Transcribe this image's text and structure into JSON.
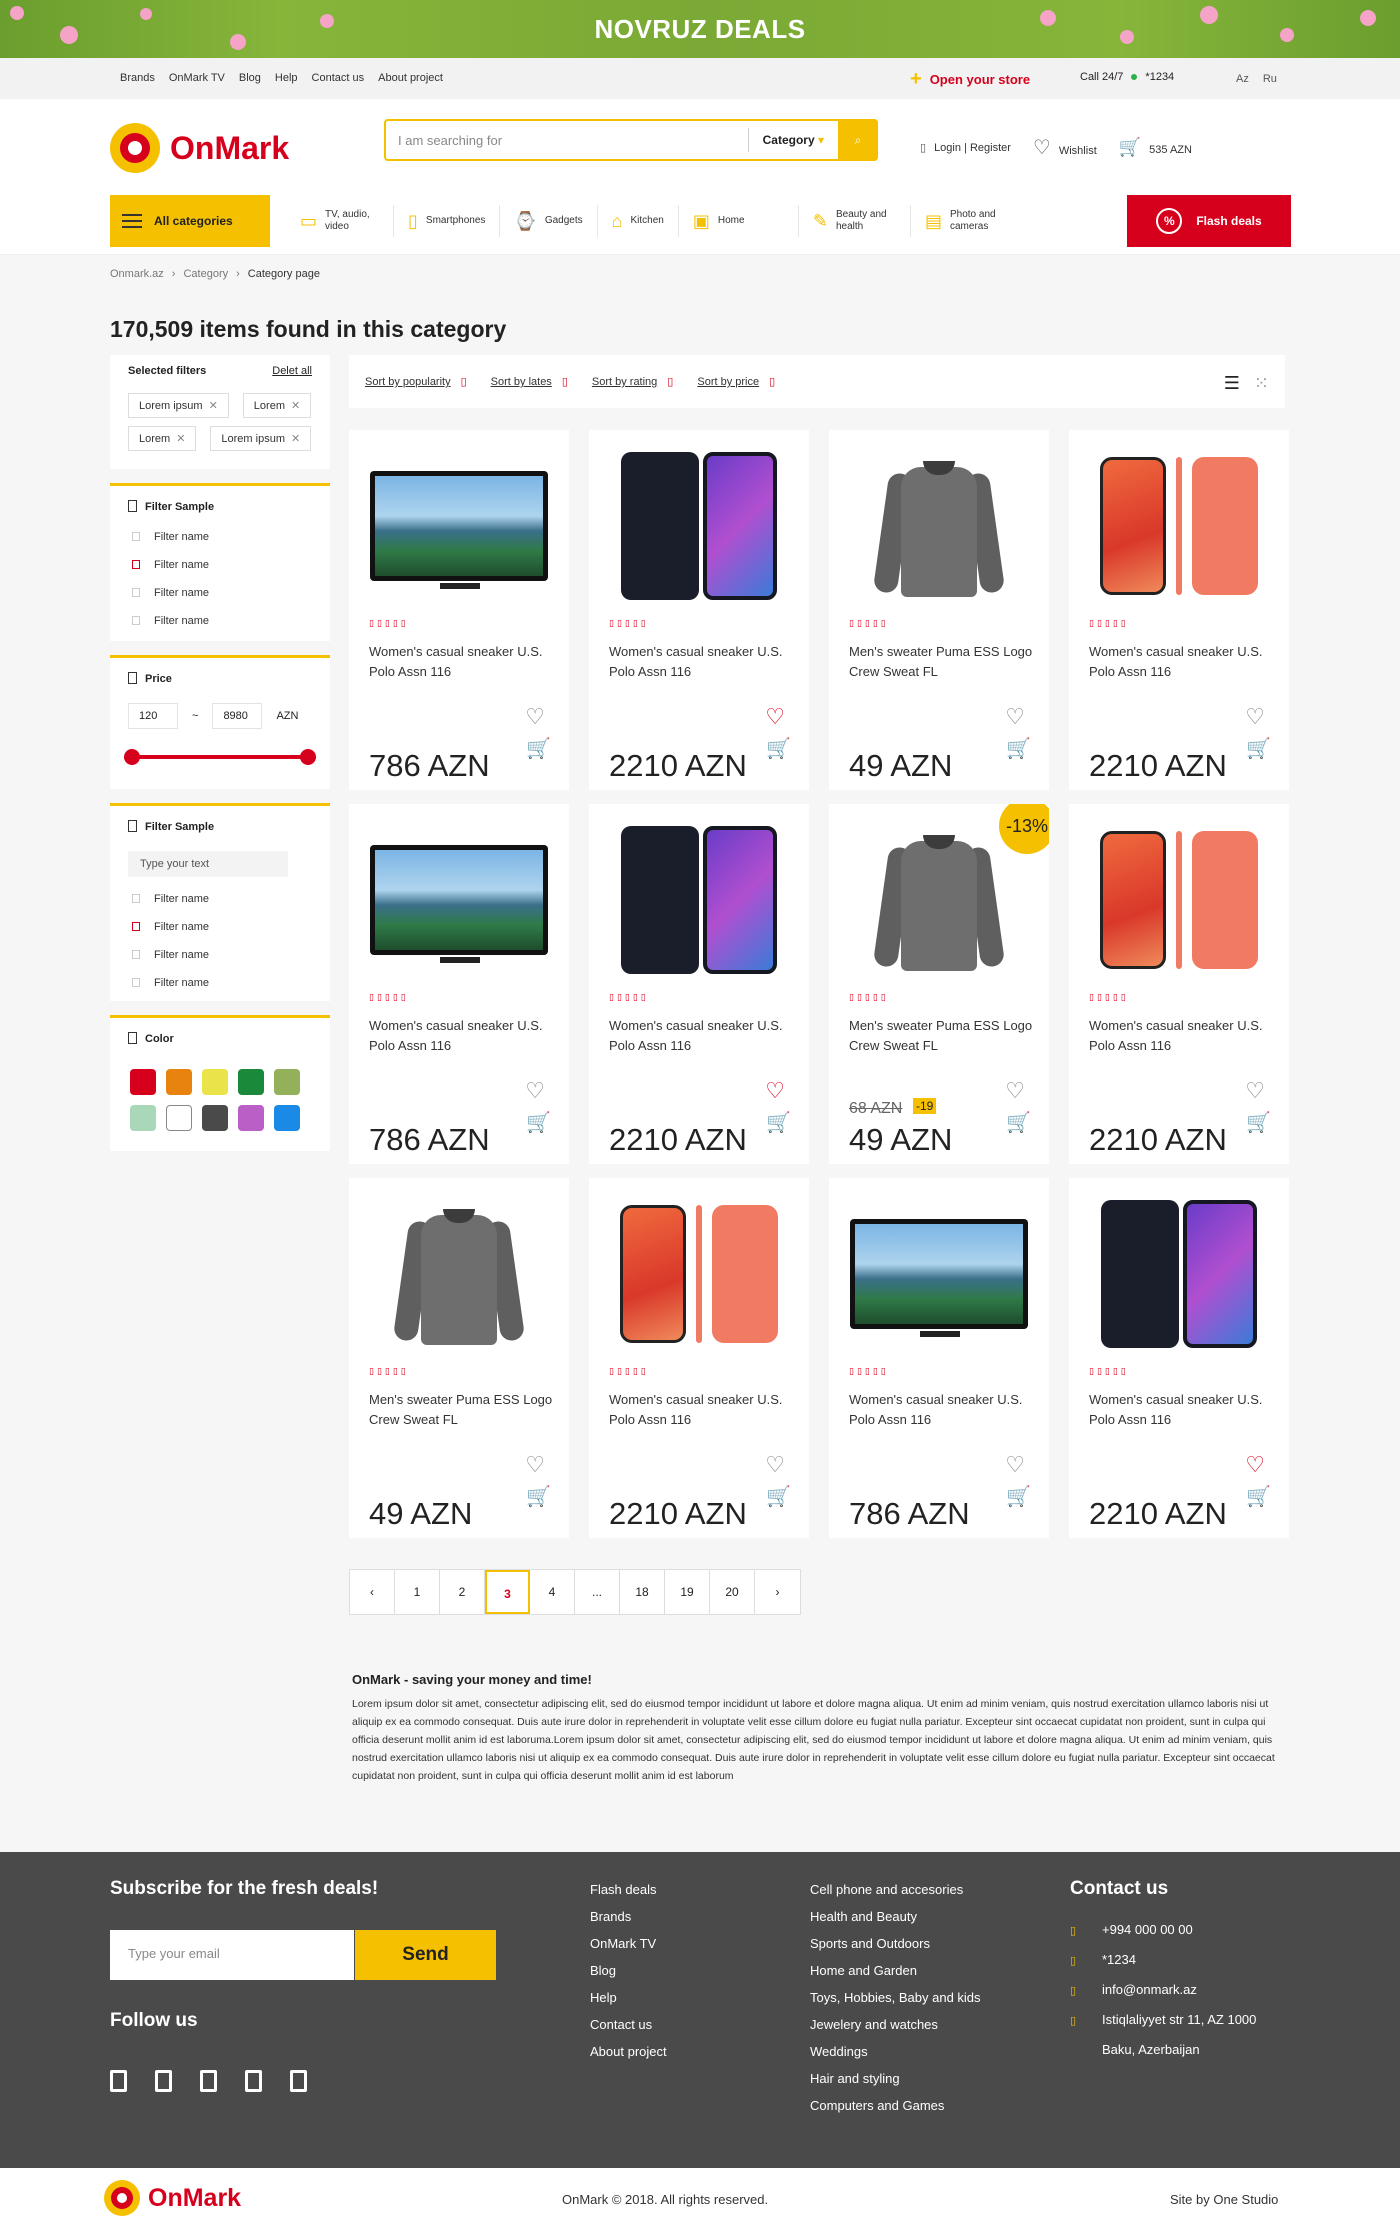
{
  "banner": {
    "title": "NOVRUZ DEALS"
  },
  "topbar": {
    "links": [
      "Brands",
      "OnMark TV",
      "Blog",
      "Help",
      "Contact us",
      "About project"
    ],
    "open_store": "Open your store",
    "call_label": "Call 24/7",
    "call_number": "*1234",
    "languages": [
      "Az",
      "Ru"
    ]
  },
  "header": {
    "logo": "OnMark",
    "search_placeholder": "I am searching for",
    "category_label": "Category",
    "login": "Login | Register",
    "wishlist": "Wishlist",
    "cart_total": "535 AZN"
  },
  "catnav": {
    "all": "All categories",
    "items": [
      {
        "label": "TV, audio, video",
        "icon": "tv-icon"
      },
      {
        "label": "Smartphones",
        "icon": "phone-icon"
      },
      {
        "label": "Gadgets",
        "icon": "watch-icon"
      },
      {
        "label": "Kitchen",
        "icon": "kitchen-icon"
      },
      {
        "label": "Home",
        "icon": "home-icon"
      },
      {
        "label": "Beauty and health",
        "icon": "hairdryer-icon"
      },
      {
        "label": "Photo and cameras",
        "icon": "camera-icon"
      }
    ],
    "flash": "Flash deals"
  },
  "breadcrumb": [
    "Onmark.az",
    "Category",
    "Category page"
  ],
  "page_title": "170,509 items found in this category",
  "filters": {
    "selected_title": "Selected filters",
    "delete_all": "Delet all",
    "tags": [
      "Lorem ipsum",
      "Lorem",
      "Lorem",
      "Lorem ipsum"
    ],
    "sample1_title": "Filter Sample",
    "sample1_items": [
      "Filter name",
      "Filter name",
      "Filter name",
      "Filter name"
    ],
    "price_title": "Price",
    "price_min": "120",
    "price_max": "8980",
    "price_unit": "AZN",
    "price_sep": "~",
    "sample2_title": "Filter Sample",
    "sample2_placeholder": "Type your text",
    "sample2_items": [
      "Filter name",
      "Filter name",
      "Filter name",
      "Filter name"
    ],
    "color_title": "Color",
    "colors": [
      "#d7001c",
      "#e8830f",
      "#ebe34a",
      "#1a8a3a",
      "#93b05a",
      "#a8d8b8",
      "#ffffff",
      "#4a4a4a",
      "#b95fc6",
      "#1a8ae6"
    ]
  },
  "sort": {
    "options": [
      "Sort by popularity",
      "Sort by lates",
      "Sort by rating",
      "Sort by price"
    ]
  },
  "products": [
    {
      "name": "Women's casual sneaker U.S. Polo Assn 116",
      "price": "786 AZN",
      "kind": "tv",
      "heart": false,
      "cart": true
    },
    {
      "name": "Women's casual sneaker U.S. Polo Assn 116",
      "price": "2210 AZN",
      "kind": "samsung",
      "heart": true,
      "cart": false
    },
    {
      "name": "Men's sweater Puma ESS Logo Crew Sweat FL",
      "price": "49 AZN",
      "kind": "sweater",
      "heart": false,
      "cart": false
    },
    {
      "name": "Women's casual sneaker U.S. Polo Assn 116",
      "price": "2210 AZN",
      "kind": "iphone",
      "heart": false,
      "cart": false
    },
    {
      "name": "Women's casual sneaker U.S. Polo Assn 116",
      "price": "786 AZN",
      "kind": "tv",
      "heart": false,
      "cart": true
    },
    {
      "name": "Women's casual sneaker U.S. Polo Assn 116",
      "price": "2210 AZN",
      "kind": "samsung",
      "heart": true,
      "cart": false
    },
    {
      "name": "Men's sweater Puma ESS Logo Crew Sweat FL",
      "price": "49 AZN",
      "kind": "sweater",
      "heart": false,
      "cart": false,
      "old_price": "68 AZN",
      "old_badge": "-19",
      "discount": "-13%"
    },
    {
      "name": "Women's casual sneaker U.S. Polo Assn 116",
      "price": "2210 AZN",
      "kind": "iphone",
      "heart": false,
      "cart": false
    },
    {
      "name": "Men's sweater Puma ESS Logo Crew Sweat FL",
      "price": "49 AZN",
      "kind": "sweater",
      "heart": false,
      "cart": false
    },
    {
      "name": "Women's casual sneaker U.S. Polo Assn 116",
      "price": "2210 AZN",
      "kind": "iphone",
      "heart": false,
      "cart": false
    },
    {
      "name": "Women's casual sneaker U.S. Polo Assn 116",
      "price": "786 AZN",
      "kind": "tv",
      "heart": false,
      "cart": true
    },
    {
      "name": "Women's casual sneaker U.S. Polo Assn 116",
      "price": "2210 AZN",
      "kind": "samsung",
      "heart": true,
      "cart": false
    }
  ],
  "pagination": {
    "pages": [
      "1",
      "2",
      "3",
      "4",
      "...",
      "18",
      "19",
      "20"
    ],
    "current": "3"
  },
  "seo": {
    "title": "OnMark - saving your money and time!",
    "text": "Lorem ipsum dolor sit amet, consectetur adipiscing elit, sed do eiusmod tempor incididunt ut labore et dolore magna aliqua. Ut enim ad minim veniam, quis nostrud exercitation ullamco laboris nisi ut aliquip ex ea commodo consequat. Duis aute irure dolor in reprehenderit in voluptate velit esse cillum dolore eu fugiat nulla pariatur. Excepteur sint occaecat cupidatat non proident, sunt in culpa qui officia deserunt mollit anim id est laboruma.Lorem ipsum dolor sit amet, consectetur adipiscing elit, sed do eiusmod tempor incididunt ut labore et dolore magna aliqua. Ut enim ad minim veniam, quis nostrud exercitation ullamco laboris nisi ut aliquip ex ea commodo consequat. Duis aute irure dolor in reprehenderit in voluptate velit esse cillum dolore eu fugiat nulla pariatur. Excepteur sint occaecat cupidatat non proident, sunt in culpa qui officia deserunt mollit anim id est laborum"
  },
  "footer": {
    "subscribe": "Subscribe for the fresh deals!",
    "email_placeholder": "Type your email",
    "send": "Send",
    "follow": "Follow us",
    "col1": [
      "Flash deals",
      "Brands",
      "OnMark TV",
      "Blog",
      "Help",
      "Contact us",
      "About project"
    ],
    "col2": [
      "Cell phone and accesories",
      "Health and Beauty",
      "Sports and Outdoors",
      "Home and Garden",
      "Toys, Hobbies, Baby and kids",
      "Jewelery and watches",
      "Weddings",
      "Hair and styling",
      "Computers and Games"
    ],
    "contact_title": "Contact us",
    "contacts": [
      "+994 000 00 00",
      "*1234",
      "info@onmark.az",
      "Istiqlaliyyet str 11, AZ 1000",
      "Baku, Azerbaijan"
    ],
    "copyright": "OnMark © 2018. All rights reserved.",
    "site_by": "Site by One Studio"
  }
}
